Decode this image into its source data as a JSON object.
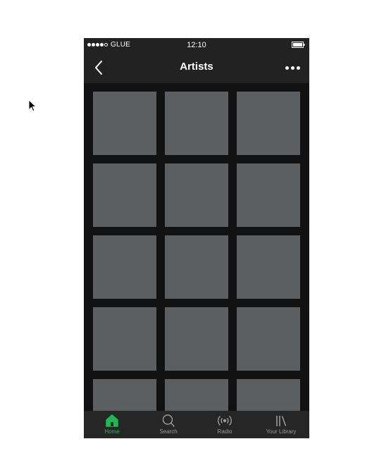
{
  "status_bar": {
    "signal_dots": [
      1,
      1,
      1,
      1,
      0
    ],
    "carrier": "GLUE",
    "time": "12:10"
  },
  "header": {
    "title": "Artists",
    "back_icon": "chevron-left-icon",
    "more_icon": "more-horizontal-icon"
  },
  "grid": {
    "tiles": 15,
    "tile_color": "#5b5f62"
  },
  "tab_bar": {
    "tabs": [
      {
        "label": "Home",
        "icon": "home-icon",
        "active": true
      },
      {
        "label": "Search",
        "icon": "search-icon",
        "active": false
      },
      {
        "label": "Radio",
        "icon": "radio-icon",
        "active": false
      },
      {
        "label": "Your Library",
        "icon": "library-icon",
        "active": false
      }
    ]
  },
  "colors": {
    "accent": "#1db954",
    "background": "#121212",
    "bar": "#222222"
  }
}
